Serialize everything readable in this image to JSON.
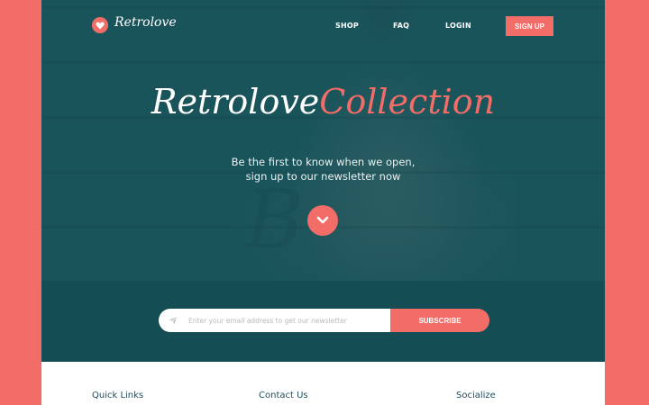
{
  "brand": {
    "name": "Retrolove",
    "accent": "#f26d68",
    "teal": "#1f5a60",
    "teal_dark": "#144d54"
  },
  "nav": {
    "links": [
      "SHOP",
      "FAQ",
      "LOGIN"
    ],
    "signup_label": "SIGN UP"
  },
  "hero": {
    "title_part1": "Retrolove",
    "title_part2": "Collection",
    "subtitle_line1": "Be the first to know when we open,",
    "subtitle_line2": "sign up to our newsletter now",
    "scroll_icon": "chevron-down-icon"
  },
  "newsletter": {
    "placeholder": "Enter your email address to get our newsletter",
    "subscribe_label": "SUBSCRIBE",
    "input_icon": "paper-plane-icon"
  },
  "footer": {
    "quick_links": "Quick Links",
    "contact_us": "Contact Us",
    "socialize": "Socialize"
  }
}
